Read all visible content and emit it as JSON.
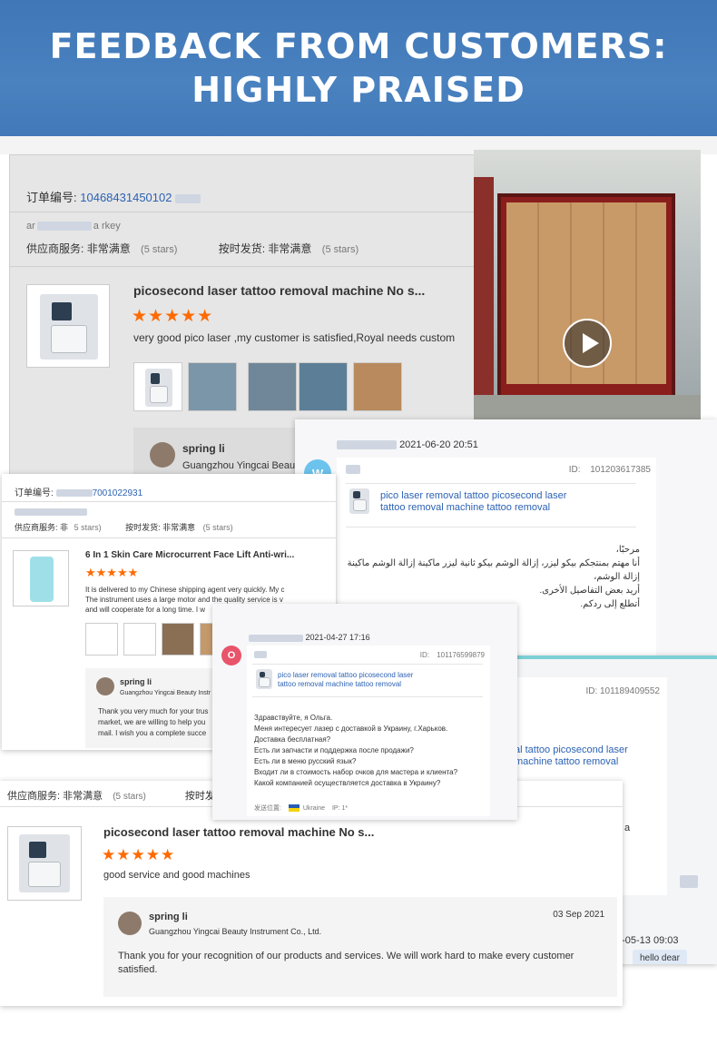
{
  "banner": {
    "line1": "FEEDBACK FROM CUSTOMERS:",
    "line2": "HIGHLY PRAISED"
  },
  "card1": {
    "order_label": "订单编号:",
    "order_no": "10468431450102",
    "buyer_prefix": "ar",
    "buyer_suffix": "a",
    "buyer_country": "rkey",
    "supplier_service_label": "供应商服务:",
    "supplier_service_value": "非常满意",
    "supplier_service_stars": "(5 stars)",
    "shipping_label": "按时发货:",
    "shipping_value": "非常满意",
    "shipping_stars": "(5 stars)",
    "product_title": "picosecond laser tattoo removal machine No s...",
    "stars": "★★★★★",
    "review": "very good pico laser ,my customer is satisfied,Royal  needs custom",
    "reply_name": "spring li",
    "reply_company": "Guangzhou Yingcai Beaut"
  },
  "card2": {
    "order_label": "订单编号:",
    "order_no": "7001022931",
    "supplier_service_label": "供应商服务:",
    "supplier_service_value": "非",
    "supplier_service_stars": "5 stars)",
    "shipping_label": "按时发货:",
    "shipping_value": "非常满意",
    "shipping_stars": "(5 stars)",
    "product_title": "6 In 1 Skin Care Microcurrent Face Lift Anti-wri...",
    "stars": "★★★★★",
    "review_line1": "It is delivered to my Chinese shipping agent very quickly. My c",
    "review_line2": "The instrument uses a large motor and the quality service is v",
    "review_line3": "and will cooperate for a long time. I w",
    "reply_name": "spring li",
    "reply_company": "Guangzhou Yingcai Beauty Instr",
    "reply_line1": "Thank you very much for your trus",
    "reply_line2": "market, we are willing to help you",
    "reply_line3": "mail. I wish you a complete succe"
  },
  "card3": {
    "date": "2021-06-20 20:51",
    "avatar_letter": "W",
    "id_label": "ID:",
    "id_value": "101203617385",
    "product_line1": "pico laser removal tattoo picosecond laser",
    "product_line2": "tattoo removal machine tattoo removal",
    "msg1": "مرحبًا،",
    "msg2": "أنا مهتم بمنتجكم بيكو ليزر، إزالة الوشم بيكو ثانية ليزر ماكينة إزالة الوشم ماكينة إزالة الوشم،",
    "msg3": "أريد بعض التفاصيل الأخرى.",
    "msg4": "أتطلع إلى ردكم."
  },
  "card4": {
    "date": "2021-04-27 17:16",
    "avatar_letter": "O",
    "id_label": "ID:",
    "id_value": "101176599879",
    "product_line1": "pico laser removal tattoo picosecond laser",
    "product_line2": "tattoo removal machine tattoo removal",
    "msg1": "Здравствуйте, я Ольга.",
    "msg2": "Меня интересует лазер с доставкой в Украину, г.Харьков.",
    "msg3": "Доставка бесплатная?",
    "msg4": "Есть ли запчасти и поддержка после продажи?",
    "msg5": "Есть ли в меню русский язык?",
    "msg6": "Входит ли в стоимость набор очков для мастера и клиента?",
    "msg7": "Какой компанией осуществляется доставка в Украину?",
    "location_label": "发送位置:",
    "location_value": "Ukraine",
    "ip_label": "IP: 1*"
  },
  "card5": {
    "id_label": "ID:",
    "id_value": "101189409552",
    "product_line1": "al tattoo picosecond laser",
    "product_line2": "machine tattoo removal",
    "fragment_a": "a",
    "date_fragment": "1-05-13 09:03",
    "hello": "hello dear"
  },
  "card6": {
    "supplier_service_label": "供应商服务:",
    "supplier_service_value": "非常满意",
    "supplier_service_stars": "(5 stars)",
    "shipping_label": "按时发货",
    "product_title": "picosecond laser tattoo removal machine No s...",
    "stars": "★★★★★",
    "review": "good service and good machines",
    "reply_name": "spring li",
    "reply_company": "Guangzhou Yingcai Beauty Instrument Co., Ltd.",
    "reply_date": "03 Sep 2021",
    "reply_line1": "Thank you for your recognition of our products and services. We will work hard to make every customer",
    "reply_line2": "satisfied."
  },
  "video": {
    "play_icon": "play-icon"
  },
  "colors": {
    "banner": "#4279b8",
    "link": "#2c62b3",
    "star": "#ff6a00",
    "avatar_w": "#6cc3ee",
    "avatar_o": "#e8546a"
  }
}
